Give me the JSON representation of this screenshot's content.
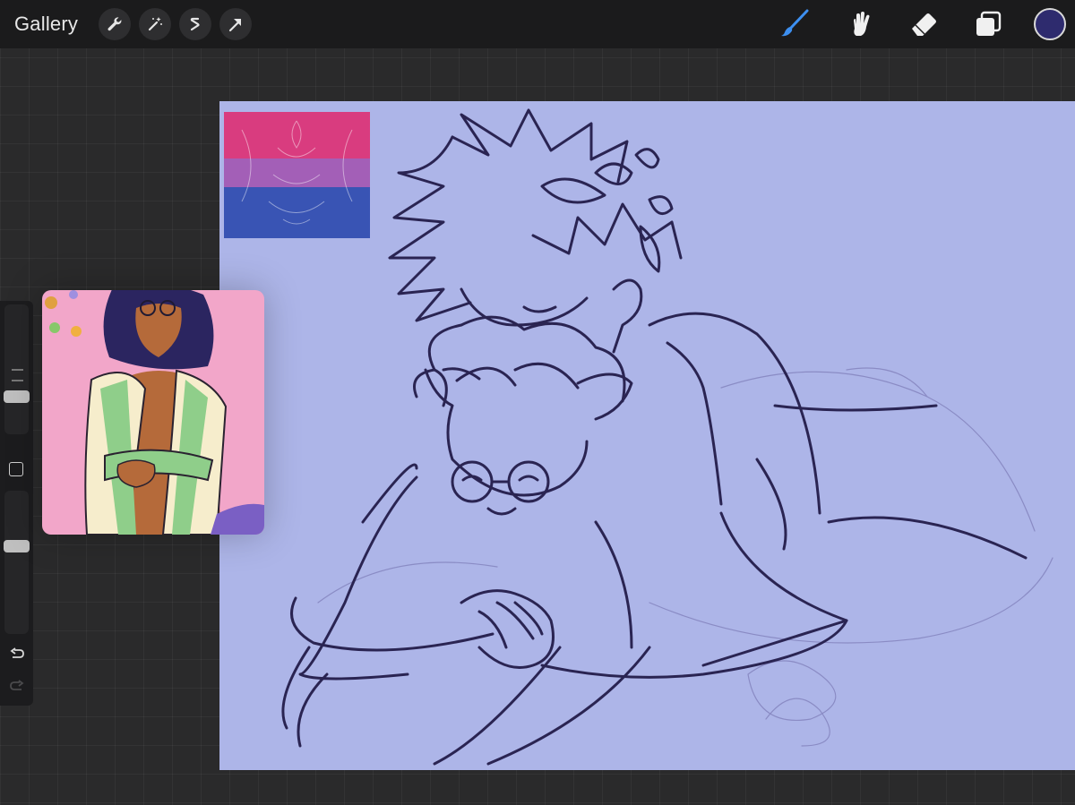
{
  "topbar": {
    "gallery_label": "Gallery",
    "left_tools": [
      "wrench-icon",
      "magic-wand-icon",
      "selection-icon",
      "transform-arrow-icon"
    ],
    "right_tools": [
      "brush-icon",
      "smudge-icon",
      "eraser-icon",
      "layers-icon"
    ],
    "active_tool": "brush-icon",
    "current_color": "#2e2b6e",
    "active_tool_color": "#3d8ff0"
  },
  "sidebar": {
    "brush_size_level": 0.27,
    "opacity_level": 0.62,
    "controls": [
      "modify-button",
      "undo-icon",
      "redo-icon"
    ]
  },
  "canvas": {
    "background_color": "#adb5e8",
    "line_color": "#2a2452"
  },
  "flag_colors": [
    "#d93c7f",
    "#a35fb7",
    "#3954b4"
  ],
  "reference": {
    "background_color": "#f2a6c9"
  }
}
